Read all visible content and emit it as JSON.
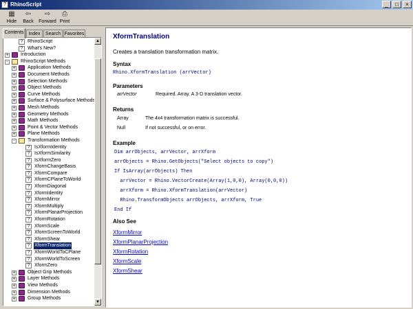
{
  "window": {
    "title": "RhinoScript",
    "icon": "help-book-icon",
    "controls": [
      "minimize-icon",
      "maximize-icon",
      "close-icon"
    ]
  },
  "toolbar": [
    {
      "label": "Hide",
      "icon": "hide-pane-icon"
    },
    {
      "label": "Back",
      "icon": "back-arrow-icon"
    },
    {
      "label": "Forward",
      "icon": "forward-arrow-icon"
    },
    {
      "label": "Print",
      "icon": "printer-icon"
    }
  ],
  "tabs": [
    {
      "label": "Contents",
      "active": true
    },
    {
      "label": "Index",
      "active": false
    },
    {
      "label": "Search",
      "active": false
    },
    {
      "label": "Favorites",
      "active": false
    }
  ],
  "tree": [
    {
      "label": "RhinoScript",
      "level": 1,
      "kind": "page",
      "expander": ""
    },
    {
      "label": "What's New?",
      "level": 1,
      "kind": "page",
      "expander": ""
    },
    {
      "label": "Introduction",
      "level": 0,
      "kind": "book",
      "expander": "+"
    },
    {
      "label": "RhinoScript Methods",
      "level": 0,
      "kind": "openbook",
      "expander": "-"
    },
    {
      "label": "Application Methods",
      "level": 1,
      "kind": "book",
      "expander": "+"
    },
    {
      "label": "Document Methods",
      "level": 1,
      "kind": "book",
      "expander": "+"
    },
    {
      "label": "Selection Methods",
      "level": 1,
      "kind": "book",
      "expander": "+"
    },
    {
      "label": "Object Methods",
      "level": 1,
      "kind": "book",
      "expander": "+"
    },
    {
      "label": "Curve Methods",
      "level": 1,
      "kind": "book",
      "expander": "+"
    },
    {
      "label": "Surface & Polysurface Methods",
      "level": 1,
      "kind": "book",
      "expander": "+"
    },
    {
      "label": "Mesh Methods",
      "level": 1,
      "kind": "book",
      "expander": "+"
    },
    {
      "label": "Geometry Methods",
      "level": 1,
      "kind": "book",
      "expander": "+"
    },
    {
      "label": "Math Methods",
      "level": 1,
      "kind": "book",
      "expander": "+"
    },
    {
      "label": "Point & Vector Methods",
      "level": 1,
      "kind": "book",
      "expander": "+"
    },
    {
      "label": "Plane Methods",
      "level": 1,
      "kind": "book",
      "expander": "+"
    },
    {
      "label": "Transformation Methods",
      "level": 1,
      "kind": "openbook",
      "expander": "-"
    },
    {
      "label": "IsXformIdentity",
      "level": 2,
      "kind": "page",
      "expander": ""
    },
    {
      "label": "IsXformSimilarity",
      "level": 2,
      "kind": "page",
      "expander": ""
    },
    {
      "label": "IsXformZero",
      "level": 2,
      "kind": "page",
      "expander": ""
    },
    {
      "label": "XformChangeBasis",
      "level": 2,
      "kind": "page",
      "expander": ""
    },
    {
      "label": "XformCompare",
      "level": 2,
      "kind": "page",
      "expander": ""
    },
    {
      "label": "XformCPlaneToWorld",
      "level": 2,
      "kind": "page",
      "expander": ""
    },
    {
      "label": "XformDiagonal",
      "level": 2,
      "kind": "page",
      "expander": ""
    },
    {
      "label": "XformIdentity",
      "level": 2,
      "kind": "page",
      "expander": ""
    },
    {
      "label": "XformMirror",
      "level": 2,
      "kind": "page",
      "expander": ""
    },
    {
      "label": "XformMultiply",
      "level": 2,
      "kind": "page",
      "expander": ""
    },
    {
      "label": "XformPlanarProjection",
      "level": 2,
      "kind": "page",
      "expander": ""
    },
    {
      "label": "XformRotation",
      "level": 2,
      "kind": "page",
      "expander": ""
    },
    {
      "label": "XformScale",
      "level": 2,
      "kind": "page",
      "expander": ""
    },
    {
      "label": "XformScreenToWorld",
      "level": 2,
      "kind": "page",
      "expander": ""
    },
    {
      "label": "XformShear",
      "level": 2,
      "kind": "page",
      "expander": ""
    },
    {
      "label": "XformTranslation",
      "level": 2,
      "kind": "page",
      "expander": "",
      "selected": true
    },
    {
      "label": "XformWorldToCPlane",
      "level": 2,
      "kind": "page",
      "expander": ""
    },
    {
      "label": "XformWorldToScreen",
      "level": 2,
      "kind": "page",
      "expander": ""
    },
    {
      "label": "XformZero",
      "level": 2,
      "kind": "page",
      "expander": ""
    },
    {
      "label": "Object Grip Methods",
      "level": 1,
      "kind": "book",
      "expander": "+"
    },
    {
      "label": "Layer Methods",
      "level": 1,
      "kind": "book",
      "expander": "+"
    },
    {
      "label": "View Methods",
      "level": 1,
      "kind": "book",
      "expander": "+"
    },
    {
      "label": "Dimension Methods",
      "level": 1,
      "kind": "book",
      "expander": "+"
    },
    {
      "label": "Group Methods",
      "level": 1,
      "kind": "book",
      "expander": "+"
    }
  ],
  "topic": {
    "title": "XformTranslation",
    "description": "Creates a translation transformation matrix.",
    "syntax_heading": "Syntax",
    "syntax": "Rhino.XformTranslation (arrVector)",
    "parameters_heading": "Parameters",
    "parameters": [
      {
        "name": "arrVector",
        "description": "Required.  Array.  A 3-D translation vector."
      }
    ],
    "returns_heading": "Returns",
    "returns": [
      {
        "type": "Array",
        "description": "The 4x4 transformation matrix is successful."
      },
      {
        "type": "Null",
        "description": "If not successful, or on error."
      }
    ],
    "example_heading": "Example",
    "example": [
      "Dim arrObjects, arrVector, arrXform",
      "arrObjects = Rhino.GetObjects(\"Select objects to copy\")",
      "If IsArray(arrObjects) Then",
      "  arrVector = Rhino.VectorCreate(Array(1,0,0), Array(0,0,0))",
      "  arrXform = Rhino.XformTranslation(arrVector)",
      "  Rhino.TransformObjects arrObjects, arrXform, True",
      "End If"
    ],
    "see_also_heading": "Also See",
    "see_also": [
      "XformMirror",
      "XformPlanarProjection",
      "XformRotation",
      "XformScale",
      "XformShear"
    ]
  }
}
